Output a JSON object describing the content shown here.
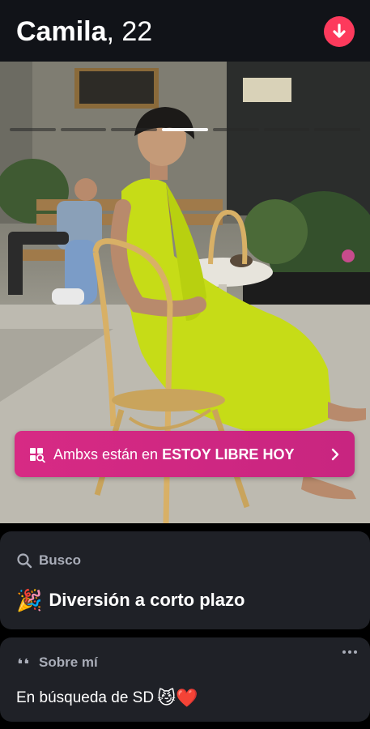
{
  "profile": {
    "name": "Camila",
    "age": ", 22"
  },
  "photo": {
    "segments": 7,
    "active_index": 3
  },
  "banner": {
    "prefix": "Ambxs están en ",
    "highlight": "ESTOY LIBRE HOY"
  },
  "looking_for": {
    "label": "Busco",
    "value": "Diversión a corto plazo",
    "emoji": "🎉"
  },
  "about": {
    "label": "Sobre mí",
    "text": "En búsqueda de SD",
    "emojis": "😼❤️"
  },
  "colors": {
    "accent": "#fd3a5c",
    "banner": "#d72a84",
    "card": "#1f2127",
    "muted": "#a9adb8"
  }
}
